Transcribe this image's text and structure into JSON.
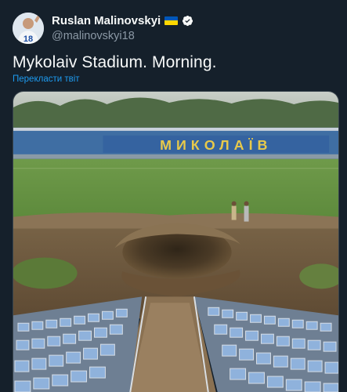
{
  "author": {
    "display_name": "Ruslan Malinovskyi",
    "handle": "@malinovskyi18",
    "avatar_number": "18",
    "verified": true,
    "flag": "ukraine-flag"
  },
  "tweet": {
    "text": "Mykolaiv Stadium. Morning.",
    "translate_label": "Перекласти твіт"
  },
  "media": {
    "stand_lettering": "МИКОЛАЇВ"
  },
  "colors": {
    "background": "#15202b",
    "link": "#1d9bf0",
    "secondary_text": "#8b98a5",
    "verified_badge": "#f7f9f9"
  }
}
